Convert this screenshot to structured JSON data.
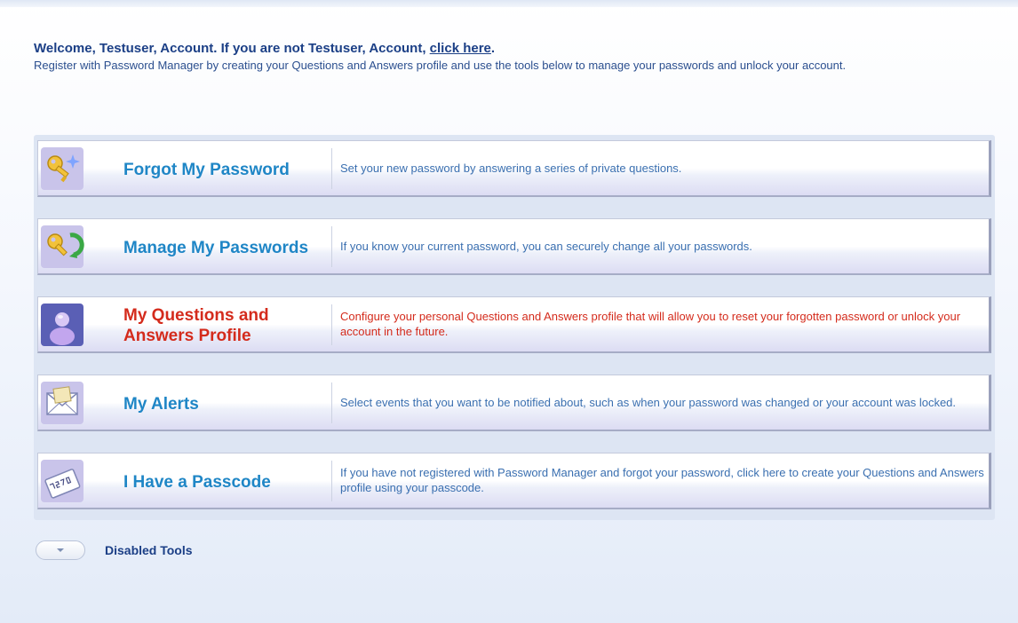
{
  "welcome": {
    "greeting_prefix": "Welcome, Testuser, Account. If you are not Testuser, Account, ",
    "link_text": "click here",
    "greeting_suffix": ".",
    "intro": "Register with Password Manager by creating your Questions and Answers profile and use the tools below to manage your passwords and unlock your account."
  },
  "tools": [
    {
      "name": "Forgot My Password",
      "description": "Set your new password by answering a series of private questions.",
      "icon": "key-sparkle-icon"
    },
    {
      "name": "Manage My Passwords",
      "description": "If you know your current password, you can securely change all your passwords.",
      "icon": "key-refresh-icon"
    },
    {
      "name": "My Questions and Answers Profile",
      "description": "Configure your personal Questions and Answers profile that will allow you to reset your forgotten password or unlock your account in the future.",
      "icon": "user-profile-icon",
      "highlight_color": "#d42b1c"
    },
    {
      "name": "My Alerts",
      "description": "Select events that you want to be notified about, such as when your password was changed or your account was locked.",
      "icon": "envelope-icon"
    },
    {
      "name": "I Have a Passcode",
      "description": "If you have not registered with Password Manager and forgot your password, click here to create your Questions and Answers profile using your passcode.",
      "icon": "passcode-card-icon"
    }
  ],
  "disabled_tools": {
    "label": "Disabled Tools",
    "icon": "chevron-down-icon"
  },
  "colors": {
    "tool_name": "#1f86c6",
    "tool_desc": "#3a6fb0",
    "welcome_text": "#1b3f86",
    "active": "#d42b1c"
  }
}
